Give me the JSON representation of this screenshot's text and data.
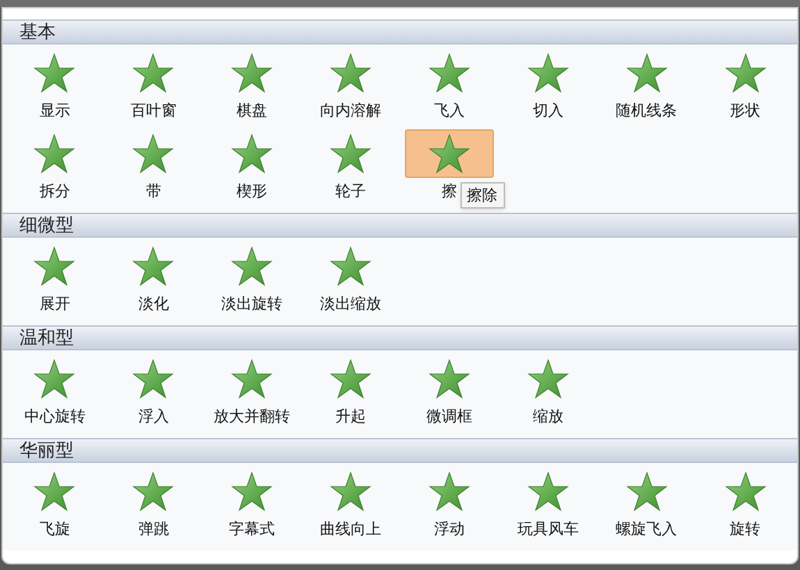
{
  "sections": [
    {
      "title": "基本",
      "items": [
        {
          "label": "显示",
          "selected": false
        },
        {
          "label": "百叶窗",
          "selected": false
        },
        {
          "label": "棋盘",
          "selected": false
        },
        {
          "label": "向内溶解",
          "selected": false
        },
        {
          "label": "飞入",
          "selected": false
        },
        {
          "label": "切入",
          "selected": false
        },
        {
          "label": "随机线条",
          "selected": false
        },
        {
          "label": "形状",
          "selected": false
        },
        {
          "label": "拆分",
          "selected": false
        },
        {
          "label": "带",
          "selected": false
        },
        {
          "label": "楔形",
          "selected": false
        },
        {
          "label": "轮子",
          "selected": false
        },
        {
          "label": "擦",
          "selected": true,
          "tooltip": "擦除"
        }
      ]
    },
    {
      "title": "细微型",
      "items": [
        {
          "label": "展开",
          "selected": false
        },
        {
          "label": "淡化",
          "selected": false
        },
        {
          "label": "淡出旋转",
          "selected": false
        },
        {
          "label": "淡出缩放",
          "selected": false
        }
      ]
    },
    {
      "title": "温和型",
      "items": [
        {
          "label": "中心旋转",
          "selected": false
        },
        {
          "label": "浮入",
          "selected": false
        },
        {
          "label": "放大并翻转",
          "selected": false
        },
        {
          "label": "升起",
          "selected": false
        },
        {
          "label": "微调框",
          "selected": false
        },
        {
          "label": "缩放",
          "selected": false
        }
      ]
    },
    {
      "title": "华丽型",
      "items": [
        {
          "label": "飞旋",
          "selected": false
        },
        {
          "label": "弹跳",
          "selected": false
        },
        {
          "label": "字幕式",
          "selected": false
        },
        {
          "label": "曲线向上",
          "selected": false
        },
        {
          "label": "浮动",
          "selected": false
        },
        {
          "label": "玩具风车",
          "selected": false
        },
        {
          "label": "螺旋飞入",
          "selected": false
        },
        {
          "label": "旋转",
          "selected": false
        }
      ]
    }
  ]
}
